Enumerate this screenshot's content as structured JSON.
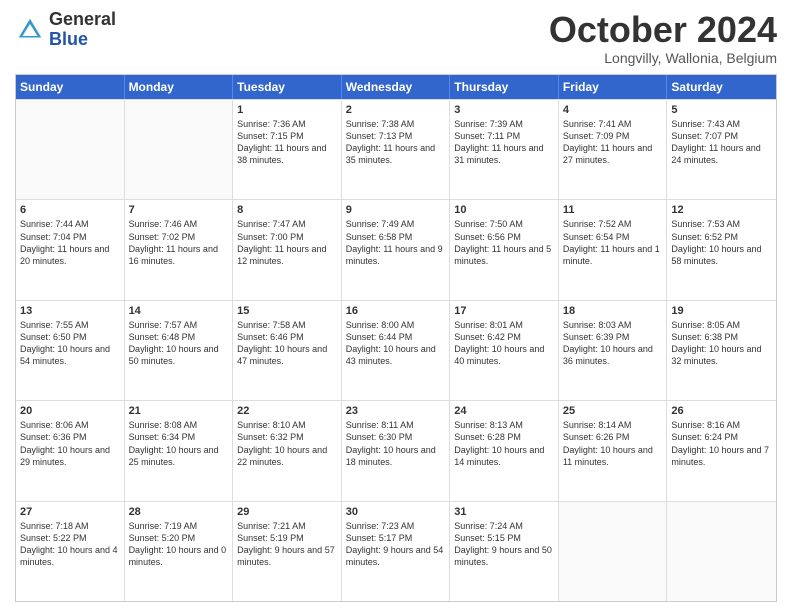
{
  "header": {
    "logo_general": "General",
    "logo_blue": "Blue",
    "title": "October 2024",
    "location": "Longvilly, Wallonia, Belgium"
  },
  "days_of_week": [
    "Sunday",
    "Monday",
    "Tuesday",
    "Wednesday",
    "Thursday",
    "Friday",
    "Saturday"
  ],
  "weeks": [
    [
      {
        "day": "",
        "empty": true
      },
      {
        "day": "",
        "empty": true
      },
      {
        "day": "1",
        "sunrise": "Sunrise: 7:36 AM",
        "sunset": "Sunset: 7:15 PM",
        "daylight": "Daylight: 11 hours and 38 minutes."
      },
      {
        "day": "2",
        "sunrise": "Sunrise: 7:38 AM",
        "sunset": "Sunset: 7:13 PM",
        "daylight": "Daylight: 11 hours and 35 minutes."
      },
      {
        "day": "3",
        "sunrise": "Sunrise: 7:39 AM",
        "sunset": "Sunset: 7:11 PM",
        "daylight": "Daylight: 11 hours and 31 minutes."
      },
      {
        "day": "4",
        "sunrise": "Sunrise: 7:41 AM",
        "sunset": "Sunset: 7:09 PM",
        "daylight": "Daylight: 11 hours and 27 minutes."
      },
      {
        "day": "5",
        "sunrise": "Sunrise: 7:43 AM",
        "sunset": "Sunset: 7:07 PM",
        "daylight": "Daylight: 11 hours and 24 minutes."
      }
    ],
    [
      {
        "day": "6",
        "sunrise": "Sunrise: 7:44 AM",
        "sunset": "Sunset: 7:04 PM",
        "daylight": "Daylight: 11 hours and 20 minutes."
      },
      {
        "day": "7",
        "sunrise": "Sunrise: 7:46 AM",
        "sunset": "Sunset: 7:02 PM",
        "daylight": "Daylight: 11 hours and 16 minutes."
      },
      {
        "day": "8",
        "sunrise": "Sunrise: 7:47 AM",
        "sunset": "Sunset: 7:00 PM",
        "daylight": "Daylight: 11 hours and 12 minutes."
      },
      {
        "day": "9",
        "sunrise": "Sunrise: 7:49 AM",
        "sunset": "Sunset: 6:58 PM",
        "daylight": "Daylight: 11 hours and 9 minutes."
      },
      {
        "day": "10",
        "sunrise": "Sunrise: 7:50 AM",
        "sunset": "Sunset: 6:56 PM",
        "daylight": "Daylight: 11 hours and 5 minutes."
      },
      {
        "day": "11",
        "sunrise": "Sunrise: 7:52 AM",
        "sunset": "Sunset: 6:54 PM",
        "daylight": "Daylight: 11 hours and 1 minute."
      },
      {
        "day": "12",
        "sunrise": "Sunrise: 7:53 AM",
        "sunset": "Sunset: 6:52 PM",
        "daylight": "Daylight: 10 hours and 58 minutes."
      }
    ],
    [
      {
        "day": "13",
        "sunrise": "Sunrise: 7:55 AM",
        "sunset": "Sunset: 6:50 PM",
        "daylight": "Daylight: 10 hours and 54 minutes."
      },
      {
        "day": "14",
        "sunrise": "Sunrise: 7:57 AM",
        "sunset": "Sunset: 6:48 PM",
        "daylight": "Daylight: 10 hours and 50 minutes."
      },
      {
        "day": "15",
        "sunrise": "Sunrise: 7:58 AM",
        "sunset": "Sunset: 6:46 PM",
        "daylight": "Daylight: 10 hours and 47 minutes."
      },
      {
        "day": "16",
        "sunrise": "Sunrise: 8:00 AM",
        "sunset": "Sunset: 6:44 PM",
        "daylight": "Daylight: 10 hours and 43 minutes."
      },
      {
        "day": "17",
        "sunrise": "Sunrise: 8:01 AM",
        "sunset": "Sunset: 6:42 PM",
        "daylight": "Daylight: 10 hours and 40 minutes."
      },
      {
        "day": "18",
        "sunrise": "Sunrise: 8:03 AM",
        "sunset": "Sunset: 6:39 PM",
        "daylight": "Daylight: 10 hours and 36 minutes."
      },
      {
        "day": "19",
        "sunrise": "Sunrise: 8:05 AM",
        "sunset": "Sunset: 6:38 PM",
        "daylight": "Daylight: 10 hours and 32 minutes."
      }
    ],
    [
      {
        "day": "20",
        "sunrise": "Sunrise: 8:06 AM",
        "sunset": "Sunset: 6:36 PM",
        "daylight": "Daylight: 10 hours and 29 minutes."
      },
      {
        "day": "21",
        "sunrise": "Sunrise: 8:08 AM",
        "sunset": "Sunset: 6:34 PM",
        "daylight": "Daylight: 10 hours and 25 minutes."
      },
      {
        "day": "22",
        "sunrise": "Sunrise: 8:10 AM",
        "sunset": "Sunset: 6:32 PM",
        "daylight": "Daylight: 10 hours and 22 minutes."
      },
      {
        "day": "23",
        "sunrise": "Sunrise: 8:11 AM",
        "sunset": "Sunset: 6:30 PM",
        "daylight": "Daylight: 10 hours and 18 minutes."
      },
      {
        "day": "24",
        "sunrise": "Sunrise: 8:13 AM",
        "sunset": "Sunset: 6:28 PM",
        "daylight": "Daylight: 10 hours and 14 minutes."
      },
      {
        "day": "25",
        "sunrise": "Sunrise: 8:14 AM",
        "sunset": "Sunset: 6:26 PM",
        "daylight": "Daylight: 10 hours and 11 minutes."
      },
      {
        "day": "26",
        "sunrise": "Sunrise: 8:16 AM",
        "sunset": "Sunset: 6:24 PM",
        "daylight": "Daylight: 10 hours and 7 minutes."
      }
    ],
    [
      {
        "day": "27",
        "sunrise": "Sunrise: 7:18 AM",
        "sunset": "Sunset: 5:22 PM",
        "daylight": "Daylight: 10 hours and 4 minutes."
      },
      {
        "day": "28",
        "sunrise": "Sunrise: 7:19 AM",
        "sunset": "Sunset: 5:20 PM",
        "daylight": "Daylight: 10 hours and 0 minutes."
      },
      {
        "day": "29",
        "sunrise": "Sunrise: 7:21 AM",
        "sunset": "Sunset: 5:19 PM",
        "daylight": "Daylight: 9 hours and 57 minutes."
      },
      {
        "day": "30",
        "sunrise": "Sunrise: 7:23 AM",
        "sunset": "Sunset: 5:17 PM",
        "daylight": "Daylight: 9 hours and 54 minutes."
      },
      {
        "day": "31",
        "sunrise": "Sunrise: 7:24 AM",
        "sunset": "Sunset: 5:15 PM",
        "daylight": "Daylight: 9 hours and 50 minutes."
      },
      {
        "day": "",
        "empty": true
      },
      {
        "day": "",
        "empty": true
      }
    ]
  ]
}
